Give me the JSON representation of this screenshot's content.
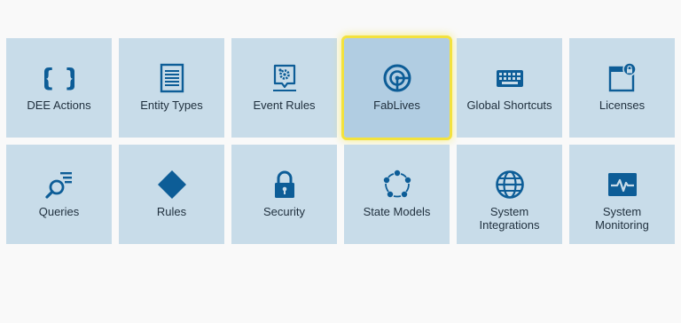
{
  "colors": {
    "tile_background": "#c8dce9",
    "tile_selected_background": "#b1cde2",
    "selection_highlight": "#f3e23e",
    "icon_color": "#0d5d97",
    "text_color": "#1f2f3d"
  },
  "selected_tile": "FabLives",
  "tiles": [
    {
      "label": "DEE Actions",
      "icon": "curly-braces-icon"
    },
    {
      "label": "Entity Types",
      "icon": "document-list-icon"
    },
    {
      "label": "Event Rules",
      "icon": "event-gear-icon"
    },
    {
      "label": "FabLives",
      "icon": "radar-icon"
    },
    {
      "label": "Global Shortcuts",
      "icon": "keyboard-icon"
    },
    {
      "label": "Licenses",
      "icon": "window-lock-icon"
    },
    {
      "label": "Queries",
      "icon": "search-list-icon"
    },
    {
      "label": "Rules",
      "icon": "diamond-icon"
    },
    {
      "label": "Security",
      "icon": "padlock-icon"
    },
    {
      "label": "State Models",
      "icon": "cycle-dots-icon"
    },
    {
      "label": "System\nIntegrations",
      "icon": "globe-icon"
    },
    {
      "label": "System\nMonitoring",
      "icon": "pulse-monitor-icon"
    }
  ]
}
